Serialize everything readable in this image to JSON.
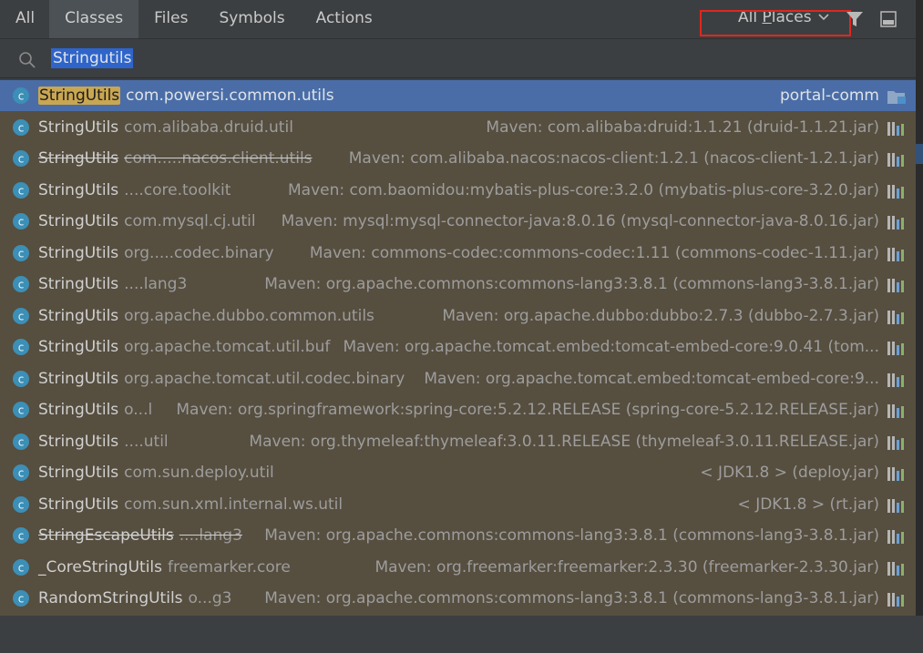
{
  "tabs": [
    "All",
    "Classes",
    "Files",
    "Symbols",
    "Actions"
  ],
  "active_tab": "Classes",
  "scope": {
    "before": "All ",
    "underlined": "P",
    "after": "laces"
  },
  "search": {
    "query": "Stringutils"
  },
  "results": [
    {
      "name_highlight": "StringUtils",
      "name_rest": "",
      "package": "com.powersi.common.utils",
      "location": "portal-comm",
      "selected": true,
      "strike": false,
      "icon": "folder-module-icon"
    },
    {
      "name_highlight": "",
      "name_rest": "StringUtils",
      "package": "com.alibaba.druid.util",
      "location": "Maven: com.alibaba:druid:1.1.21 (druid-1.1.21.jar)",
      "selected": false,
      "strike": false,
      "icon": "library-icon"
    },
    {
      "name_highlight": "",
      "name_rest": "StringUtils",
      "package": "com.....nacos.client.utils",
      "location": "Maven: com.alibaba.nacos:nacos-client:1.2.1 (nacos-client-1.2.1.jar)",
      "selected": false,
      "strike": true,
      "icon": "library-icon"
    },
    {
      "name_highlight": "",
      "name_rest": "StringUtils",
      "package": "....core.toolkit",
      "location": "Maven: com.baomidou:mybatis-plus-core:3.2.0 (mybatis-plus-core-3.2.0.jar)",
      "selected": false,
      "strike": false,
      "icon": "library-icon"
    },
    {
      "name_highlight": "",
      "name_rest": "StringUtils",
      "package": "com.mysql.cj.util",
      "location": "Maven: mysql:mysql-connector-java:8.0.16 (mysql-connector-java-8.0.16.jar)",
      "selected": false,
      "strike": false,
      "icon": "library-icon"
    },
    {
      "name_highlight": "",
      "name_rest": "StringUtils",
      "package": "org.....codec.binary",
      "location": "Maven: commons-codec:commons-codec:1.11 (commons-codec-1.11.jar)",
      "selected": false,
      "strike": false,
      "icon": "library-icon"
    },
    {
      "name_highlight": "",
      "name_rest": "StringUtils",
      "package": "....lang3",
      "location": "Maven: org.apache.commons:commons-lang3:3.8.1 (commons-lang3-3.8.1.jar)",
      "selected": false,
      "strike": false,
      "icon": "library-icon"
    },
    {
      "name_highlight": "",
      "name_rest": "StringUtils",
      "package": "org.apache.dubbo.common.utils",
      "location": "Maven: org.apache.dubbo:dubbo:2.7.3 (dubbo-2.7.3.jar)",
      "selected": false,
      "strike": false,
      "icon": "library-icon"
    },
    {
      "name_highlight": "",
      "name_rest": "StringUtils",
      "package": "org.apache.tomcat.util.buf",
      "location": "Maven: org.apache.tomcat.embed:tomcat-embed-core:9.0.41 (tom...",
      "selected": false,
      "strike": false,
      "icon": "library-icon"
    },
    {
      "name_highlight": "",
      "name_rest": "StringUtils",
      "package": "org.apache.tomcat.util.codec.binary",
      "location": "Maven: org.apache.tomcat.embed:tomcat-embed-core:9...",
      "selected": false,
      "strike": false,
      "icon": "library-icon"
    },
    {
      "name_highlight": "",
      "name_rest": "StringUtils",
      "package": "o...l",
      "location": "Maven: org.springframework:spring-core:5.2.12.RELEASE (spring-core-5.2.12.RELEASE.jar)",
      "selected": false,
      "strike": false,
      "icon": "library-icon"
    },
    {
      "name_highlight": "",
      "name_rest": "StringUtils",
      "package": "....util",
      "location": "Maven: org.thymeleaf:thymeleaf:3.0.11.RELEASE (thymeleaf-3.0.11.RELEASE.jar)",
      "selected": false,
      "strike": false,
      "icon": "library-icon"
    },
    {
      "name_highlight": "",
      "name_rest": "StringUtils",
      "package": "com.sun.deploy.util",
      "location": "< JDK1.8 > (deploy.jar)",
      "selected": false,
      "strike": false,
      "icon": "library-icon"
    },
    {
      "name_highlight": "",
      "name_rest": "StringUtils",
      "package": "com.sun.xml.internal.ws.util",
      "location": "< JDK1.8 > (rt.jar)",
      "selected": false,
      "strike": false,
      "icon": "library-icon"
    },
    {
      "name_highlight": "",
      "name_rest": "StringEscapeUtils",
      "package": "....lang3",
      "location": "Maven: org.apache.commons:commons-lang3:3.8.1 (commons-lang3-3.8.1.jar)",
      "selected": false,
      "strike": true,
      "icon": "library-icon"
    },
    {
      "name_highlight": "",
      "name_rest": "_CoreStringUtils",
      "package": "freemarker.core",
      "location": "Maven: org.freemarker:freemarker:2.3.30 (freemarker-2.3.30.jar)",
      "selected": false,
      "strike": false,
      "icon": "library-icon"
    },
    {
      "name_highlight": "",
      "name_rest": "RandomStringUtils",
      "package": "o...g3",
      "location": "Maven: org.apache.commons:commons-lang3:3.8.1 (commons-lang3-3.8.1.jar)",
      "selected": false,
      "strike": false,
      "icon": "library-icon"
    }
  ],
  "colors": {
    "accent_border": "#e0271f",
    "selection": "#4a6da7",
    "query_highlight": "#c9a650",
    "list_background": "#564e3f"
  }
}
